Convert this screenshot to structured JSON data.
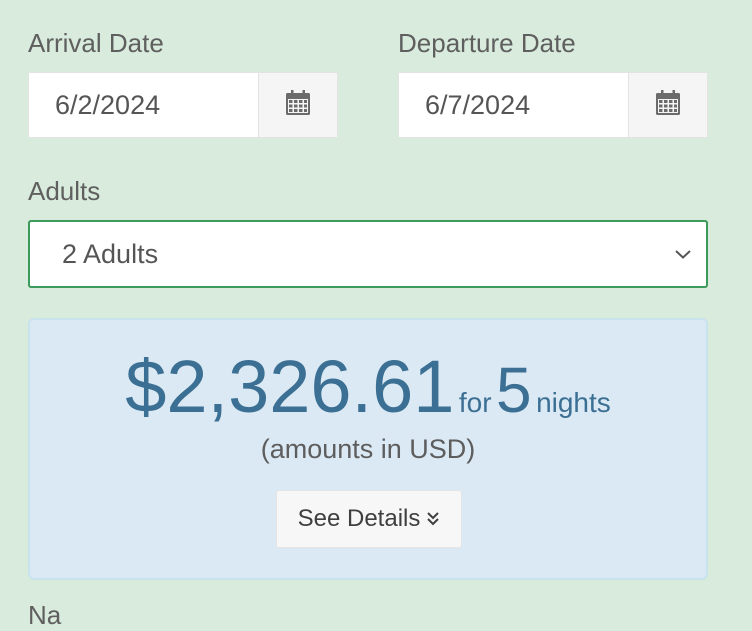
{
  "arrival": {
    "label": "Arrival Date",
    "value": "6/2/2024"
  },
  "departure": {
    "label": "Departure Date",
    "value": "6/7/2024"
  },
  "adults": {
    "label": "Adults",
    "selected": "2 Adults"
  },
  "price": {
    "amount": "$2,326.61",
    "for_text": "for",
    "nights": "5",
    "nights_text": "nights",
    "currency_note": "(amounts in USD)",
    "details_label": "See Details"
  },
  "next_field": {
    "label": "Na"
  },
  "colors": {
    "background": "#d8ebdd",
    "price_text": "#3b6f93",
    "price_box": "#dbe9f4",
    "select_border": "#3c9a5a"
  },
  "icons": {
    "date_button": "calendar-icon",
    "select_arrow": "chevron-down-icon",
    "details_arrow": "double-chevron-down-icon"
  }
}
